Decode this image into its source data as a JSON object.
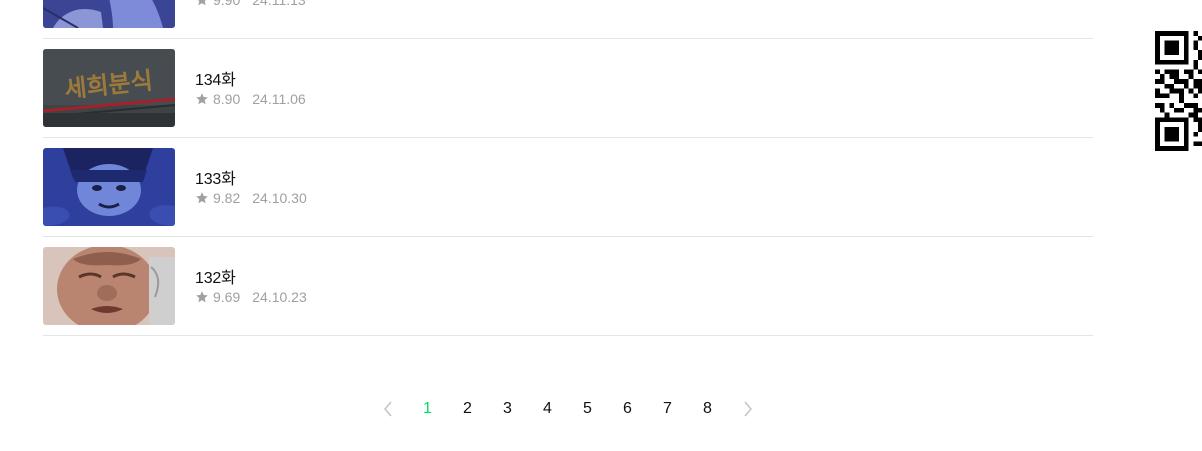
{
  "episodes": [
    {
      "title": "",
      "rating": "9.90",
      "date": "24.11.13"
    },
    {
      "title": "134화",
      "rating": "8.90",
      "date": "24.11.06"
    },
    {
      "title": "133화",
      "rating": "9.82",
      "date": "24.10.30"
    },
    {
      "title": "132화",
      "rating": "9.69",
      "date": "24.10.23"
    }
  ],
  "thumbnail_text": {
    "ep134_sign": "세희분식"
  },
  "pagination": {
    "pages": [
      "1",
      "2",
      "3",
      "4",
      "5",
      "6",
      "7",
      "8"
    ],
    "current": "1"
  },
  "icons": {
    "rating": "star-icon",
    "prev": "chevron-left-icon",
    "next": "chevron-right-icon"
  },
  "colors": {
    "accent": "#00dc64",
    "meta_text": "#a0a0a0",
    "divider": "#e5e5e5"
  }
}
